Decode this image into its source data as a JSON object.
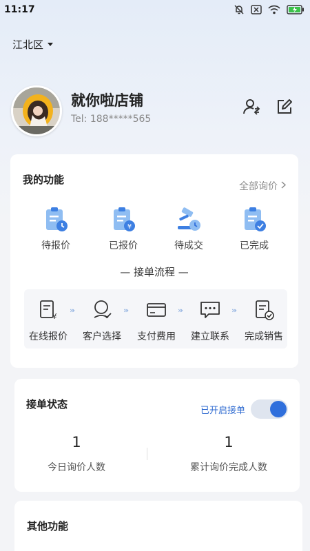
{
  "status_bar": {
    "time": "11:17",
    "icons": [
      "mute-bell-icon",
      "sim-error-icon",
      "wifi-icon",
      "battery-charging-icon"
    ],
    "battery_color": "#3cc24a"
  },
  "location": {
    "label": "江北区",
    "icon": "caret-down-icon"
  },
  "profile": {
    "shop_name": "就你啦店铺",
    "tel": "Tel: 188*****565",
    "actions": [
      "switch-user-icon",
      "edit-icon"
    ]
  },
  "functions": {
    "title": "我的功能",
    "all_link": "全部询价",
    "items": [
      {
        "label": "待报价",
        "icon": "clipboard-clock-icon"
      },
      {
        "label": "已报价",
        "icon": "clipboard-yen-icon"
      },
      {
        "label": "待成交",
        "icon": "gavel-clock-icon"
      },
      {
        "label": "已完成",
        "icon": "clipboard-check-icon"
      }
    ],
    "flow_title": "— 接单流程 —",
    "flow": [
      {
        "label": "在线报价",
        "icon": "yen-document-icon"
      },
      {
        "label": "客户选择",
        "icon": "user-check-icon"
      },
      {
        "label": "支付费用",
        "icon": "card-icon"
      },
      {
        "label": "建立联系",
        "icon": "chat-icon"
      },
      {
        "label": "完成销售",
        "icon": "document-check-icon"
      }
    ]
  },
  "order_status": {
    "title": "接单状态",
    "toggle_label": "已开启接单",
    "toggle_on": true,
    "stats": [
      {
        "value": "1",
        "label": "今日询价人数"
      },
      {
        "value": "1",
        "label": "累计询价完成人数"
      }
    ]
  },
  "other": {
    "title": "其他功能"
  },
  "colors": {
    "accent": "#2f6fdc",
    "icon_blue": "#3d7fe2",
    "icon_light": "#8fbdf2"
  }
}
